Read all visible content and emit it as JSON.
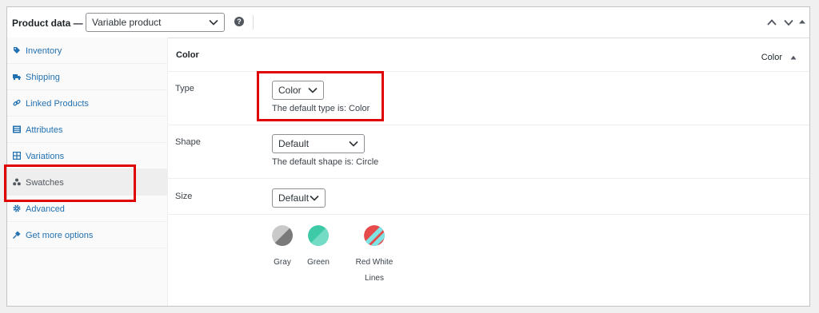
{
  "header": {
    "title": "Product data —",
    "product_type": "Variable product",
    "help_glyph": "?",
    "help_icon": "question-circle"
  },
  "tabs": [
    {
      "label": "Inventory",
      "icon": "tag-icon"
    },
    {
      "label": "Shipping",
      "icon": "truck-icon"
    },
    {
      "label": "Linked Products",
      "icon": "link-icon"
    },
    {
      "label": "Attributes",
      "icon": "list-icon"
    },
    {
      "label": "Variations",
      "icon": "grid-icon"
    },
    {
      "label": "Swatches",
      "icon": "dots-icon",
      "active": true
    },
    {
      "label": "Advanced",
      "icon": "gear-icon"
    },
    {
      "label": "Get more options",
      "icon": "plugin-icon"
    }
  ],
  "panel": {
    "attribute_name": "Color",
    "attribute_value": "Color",
    "rows": {
      "type": {
        "label": "Type",
        "selected": "Color",
        "desc": "The default type is: Color"
      },
      "shape": {
        "label": "Shape",
        "selected": "Default",
        "desc": "The default shape is: Circle"
      },
      "size": {
        "label": "Size",
        "selected": "Default"
      }
    },
    "swatches": [
      {
        "label": "Gray",
        "colors": [
          "#c9c9c9",
          "#7a7a7a"
        ]
      },
      {
        "label": "Green",
        "colors": [
          "#3ec9a7",
          "#74dcc4"
        ]
      },
      {
        "label_lines": [
          "Red White",
          "Lines"
        ],
        "colors": [
          "#e64b4b",
          "#7fe3e3"
        ]
      }
    ]
  },
  "colors": {
    "highlight": "#e00000",
    "link": "#2271b1",
    "border": "#c3c4c7"
  }
}
